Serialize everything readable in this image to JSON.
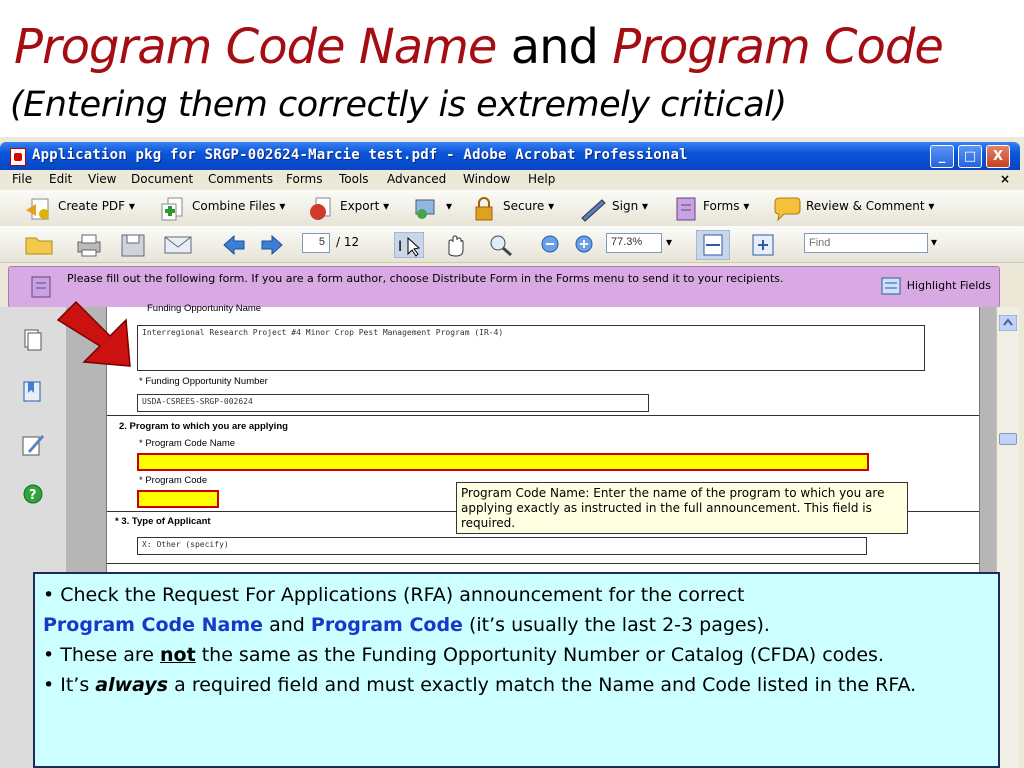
{
  "slide": {
    "title": {
      "part1": "Program Code Name",
      "part2": "and",
      "part3": "Program Code"
    },
    "subtitle": "(Entering them correctly is extremely critical)"
  },
  "window": {
    "title": "Application pkg for SRGP-002624-Marcie test.pdf - Adobe Acrobat Professional",
    "controls": {
      "minimize": "_",
      "maximize": "□",
      "close": "X"
    }
  },
  "menu": [
    "File",
    "Edit",
    "View",
    "Document",
    "Comments",
    "Forms",
    "Tools",
    "Advanced",
    "Window",
    "Help"
  ],
  "menu_close": "×",
  "toolbar1": {
    "create_pdf": "Create PDF",
    "combine_files": "Combine Files",
    "export": "Export",
    "secure": "Secure",
    "sign": "Sign",
    "forms": "Forms",
    "review_comment": "Review & Comment",
    "dropdown_arrow": "▾"
  },
  "toolbar2": {
    "page_current": "5",
    "page_total": "/ 12",
    "zoom": "77.3%",
    "find_placeholder": "Find"
  },
  "notice": {
    "text": "Please fill out the following form. If you are a form author, choose Distribute Form in the Forms menu to send it to your recipients.",
    "highlight_fields": "Highlight Fields"
  },
  "form": {
    "partial_label": "Funding Opportunity Name",
    "funding_opportunity_name_value": "Interregional Research Project #4 Minor Crop Pest Management Program (IR-4)",
    "funding_opportunity_number_label": "* Funding Opportunity Number",
    "funding_opportunity_number_value": "USDA-CSREES-SRGP-002624",
    "program_heading": "2. Program  to which you are applying",
    "program_code_name_label": "* Program Code Name",
    "program_code_label": "* Program Code",
    "type_of_applicant_label": "* 3. Type of Applicant",
    "type_of_applicant_value": "X: Other (specify)"
  },
  "tooltip": "Program Code Name: Enter the name of the program to which you are applying exactly as instructed in the full announcement. This field is required.",
  "note": {
    "b1_pre": "•  Check the Request For Applications (RFA) announcement for the correct",
    "b1_bold1": "Program Code Name",
    "b1_and": " and ",
    "b1_bold2": "Program Code",
    "b1_post": " (it’s usually the last 2-3 pages).",
    "b2_pre": "•  These are ",
    "b2_not": "not",
    "b2_post": " the same as the Funding Opportunity Number or Catalog (CFDA) codes.",
    "b3_pre": "•  It’s ",
    "b3_always": "always",
    "b3_post": " a required field and must exactly match the Name and Code listed in the RFA."
  },
  "colors": {
    "title_red": "#a50d12",
    "note_bg": "#ccffff",
    "note_bold_blue": "#1838c8",
    "field_highlight": "#ffff00",
    "arrow": "#cc1111"
  }
}
